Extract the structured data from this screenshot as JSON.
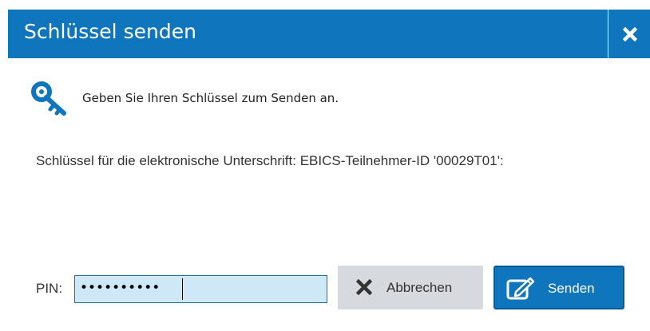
{
  "dialog": {
    "title": "Schlüssel senden",
    "close_icon": "close-icon",
    "intro_icon": "key-icon",
    "intro_text": "Geben Sie Ihren Schlüssel zum Senden an.",
    "key_info": "Schlüssel für die elektronische Unterschrift: EBICS-Teilnehmer-ID '00029T01':"
  },
  "form": {
    "pin_label": "PIN:",
    "pin_masked": "••••••••••"
  },
  "buttons": {
    "cancel_label": "Abbrechen",
    "cancel_icon": "x-icon",
    "send_label": "Senden",
    "send_icon": "edit-icon"
  },
  "colors": {
    "accent": "#0f75bc",
    "input_bg": "#cfe8f7",
    "cancel_bg": "#d6d9dd"
  }
}
